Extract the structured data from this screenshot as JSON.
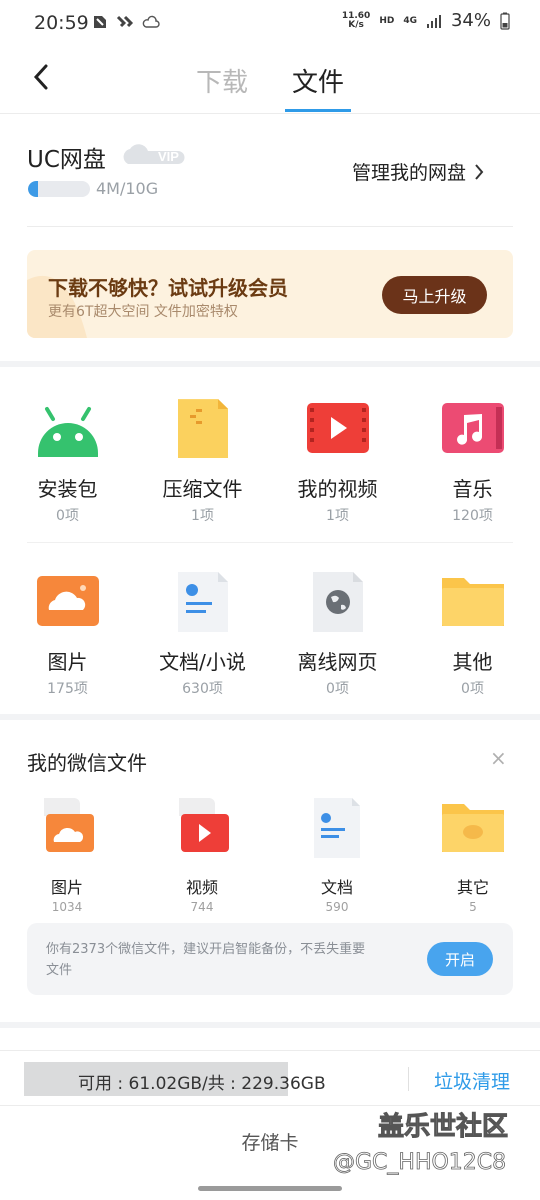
{
  "status_bar": {
    "time": "20:59",
    "net_speed_value": "11.60",
    "net_speed_unit": "K/s",
    "hd": "HD",
    "network": "4G",
    "battery": "34%"
  },
  "nav": {
    "tabs": [
      {
        "label": "下载",
        "active": false
      },
      {
        "label": "文件",
        "active": true
      }
    ]
  },
  "disk": {
    "title": "UC网盘",
    "vip_label": "VIP",
    "usage_text": "4M/10G",
    "usage_fraction": 0.0004,
    "manage_label": "管理我的网盘"
  },
  "promo": {
    "title": "下载不够快？试试升级会员",
    "subtitle": "更有6T超大空间 文件加密特权",
    "button": "马上升级"
  },
  "categories": [
    {
      "name": "安装包",
      "count": "0项",
      "icon": "android-icon"
    },
    {
      "name": "压缩文件",
      "count": "1项",
      "icon": "zip-icon"
    },
    {
      "name": "我的视频",
      "count": "1项",
      "icon": "video-icon"
    },
    {
      "name": "音乐",
      "count": "120项",
      "icon": "music-icon"
    },
    {
      "name": "图片",
      "count": "175项",
      "icon": "image-icon"
    },
    {
      "name": "文档/小说",
      "count": "630项",
      "icon": "document-icon"
    },
    {
      "name": "离线网页",
      "count": "0项",
      "icon": "globe-icon"
    },
    {
      "name": "其他",
      "count": "0项",
      "icon": "folder-icon"
    }
  ],
  "wechat": {
    "title": "我的微信文件",
    "close": "×",
    "items": [
      {
        "name": "图片",
        "count": "1034",
        "icon": "wechat-image-icon"
      },
      {
        "name": "视频",
        "count": "744",
        "icon": "wechat-video-icon"
      },
      {
        "name": "文档",
        "count": "590",
        "icon": "wechat-document-icon"
      },
      {
        "name": "其它",
        "count": "5",
        "icon": "wechat-folder-icon"
      }
    ],
    "backup_text": "你有2373个微信文件，建议开启智能备份，不丢失重要文件",
    "backup_button": "开启"
  },
  "storage": {
    "text": "可用 : 61.02GB/共 : 229.36GB",
    "clean_button": "垃圾清理",
    "label": "存储卡"
  },
  "watermark": {
    "line1": "盖乐世社区",
    "line2": "@GC_HHO12C8"
  },
  "colors": {
    "accent": "#2f9be8",
    "promo_bg": "#fdf2df",
    "promo_button": "#6b3319"
  }
}
